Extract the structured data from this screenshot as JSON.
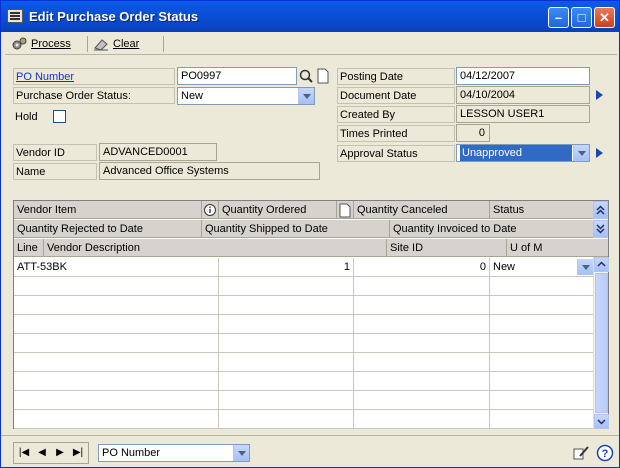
{
  "window": {
    "title": "Edit Purchase Order Status"
  },
  "toolbar": {
    "process": "Process",
    "clear": "Clear"
  },
  "form": {
    "po_number_label": "PO Number",
    "po_number": "PO0997",
    "po_status_label": "Purchase Order Status:",
    "po_status": "New",
    "hold_label": "Hold",
    "vendor_id_label": "Vendor ID",
    "vendor_id": "ADVANCED0001",
    "name_label": "Name",
    "name": "Advanced Office Systems",
    "posting_date_label": "Posting Date",
    "posting_date": "04/12/2007",
    "document_date_label": "Document Date",
    "document_date": "04/10/2004",
    "created_by_label": "Created By",
    "created_by": "LESSON USER1",
    "times_printed_label": "Times Printed",
    "times_printed": "0",
    "approval_status_label": "Approval Status",
    "approval_status": "Unapproved"
  },
  "grid": {
    "headers": {
      "vendor_item": "Vendor Item",
      "quantity_ordered": "Quantity Ordered",
      "quantity_canceled": "Quantity Canceled",
      "status": "Status",
      "quantity_rejected": "Quantity Rejected to Date",
      "quantity_shipped": "Quantity Shipped to Date",
      "quantity_invoiced": "Quantity Invoiced to Date",
      "line": "Line",
      "vendor_description": "Vendor Description",
      "site_id": "Site ID",
      "u_of_m": "U of M"
    },
    "rows": [
      {
        "vendor_item": "ATT-53BK",
        "quantity_ordered": "1",
        "quantity_canceled": "0",
        "status": "New"
      }
    ]
  },
  "bottom": {
    "sort_by": "PO Number"
  }
}
